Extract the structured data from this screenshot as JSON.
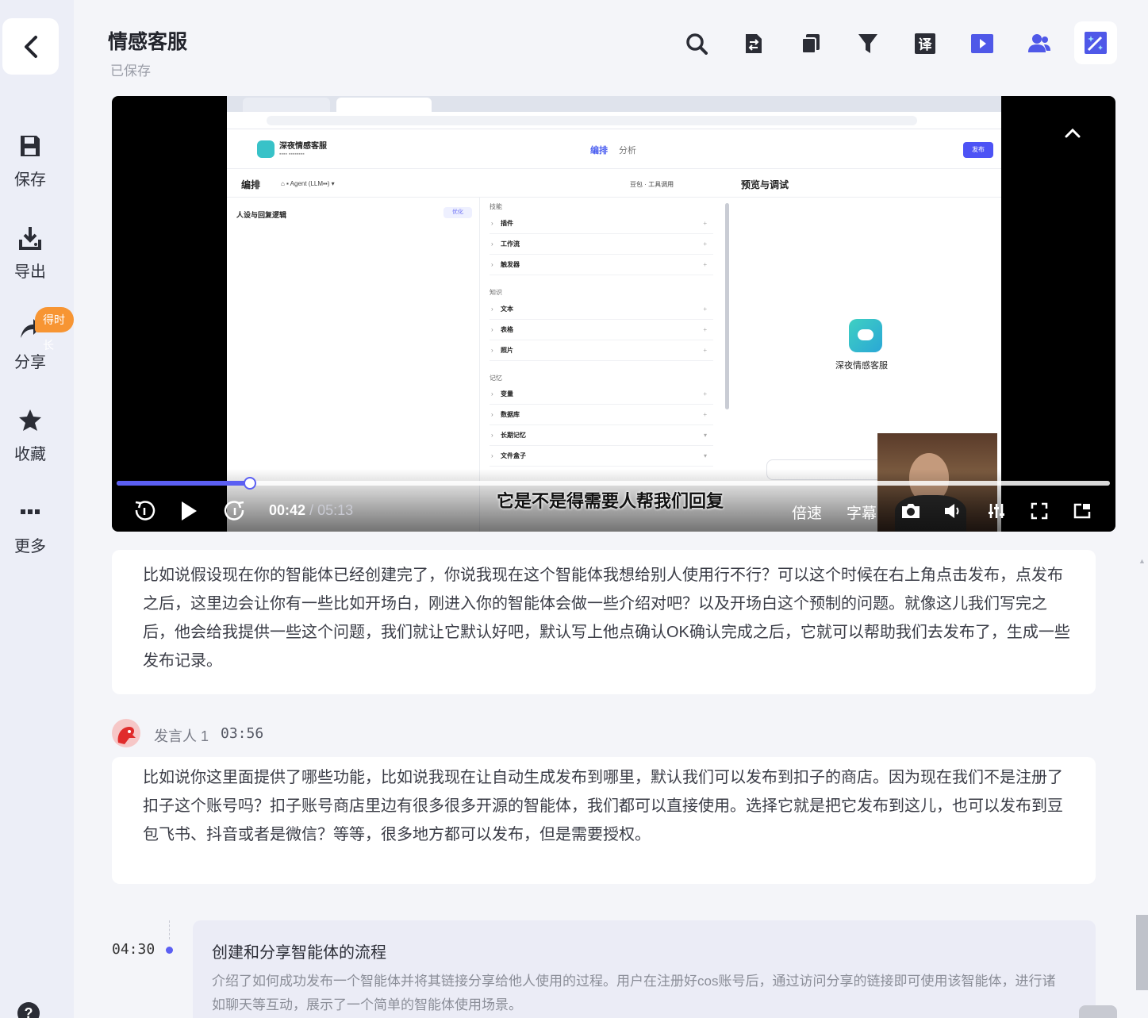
{
  "sidebar": {
    "items": [
      {
        "icon": "save-icon",
        "label": "保存"
      },
      {
        "icon": "export-icon",
        "label": "导出"
      },
      {
        "icon": "share-icon",
        "label": "分享"
      },
      {
        "icon": "star-icon",
        "label": "收藏"
      },
      {
        "icon": "more-icon",
        "label": "更多"
      }
    ],
    "share_badge": "得时长"
  },
  "header": {
    "title": "情感客服",
    "status": "已保存"
  },
  "toolbar": {
    "icons": [
      "search-icon",
      "summary-icon",
      "copy-icon",
      "filter-icon",
      "translate-icon",
      "video-icon",
      "speakers-icon",
      "magic-edit-icon"
    ],
    "translate_glyph": "译"
  },
  "video": {
    "current_time": "00:42",
    "duration": "05:13",
    "progress_fraction": 0.134,
    "subtitle": "它是不是得需要人帮我们回复",
    "speed_label": "倍速",
    "captions_label": "字幕",
    "screen": {
      "app_name": "深夜情感客服",
      "tab_edit": "编排",
      "tab_analyze": "分析",
      "publish": "发布",
      "section_edit": "编排",
      "model": "豆包 · 工具调用",
      "section_preview": "预览与调试",
      "persona_title": "人设与回复逻辑",
      "optimize": "优化",
      "skills_label": "技能",
      "skills": [
        "插件",
        "工作流",
        "触发器"
      ],
      "knowledge_label": "知识",
      "knowledge": [
        "文本",
        "表格",
        "照片"
      ],
      "memory_label": "记忆",
      "memory": [
        "变量",
        "数据库",
        "长期记忆",
        "文件盒子"
      ],
      "bot_name": "深夜情感客服"
    }
  },
  "transcript": [
    {
      "text": "比如说假设现在你的智能体已经创建完了，你说我现在这个智能体我想给别人使用行不行？可以这个时候在右上角点击发布，点发布之后，这里边会让你有一些比如开场白，刚进入你的智能体会做一些介绍对吧？以及开场白这个预制的问题。就像这儿我们写完之后，他会给我提供一些这个问题，我们就让它默认好吧，默认写上他点确认OK确认完成之后，它就可以帮助我们去发布了，生成一些发布记录。"
    },
    {
      "speaker": "发言人 1",
      "time": "03:56",
      "text": "比如说你这里面提供了哪些功能，比如说我现在让自动生成发布到哪里，默认我们可以发布到扣子的商店。因为现在我们不是注册了扣子这个账号吗？扣子账号商店里边有很多很多开源的智能体，我们都可以直接使用。选择它就是把它发布到这儿，也可以发布到豆包飞书、抖音或者是微信？等等，很多地方都可以发布，但是需要授权。"
    }
  ],
  "chapter": {
    "time": "04:30",
    "title": "创建和分享智能体的流程",
    "description": "介绍了如何成功发布一个智能体并将其链接分享给他人使用的过程。用户在注册好cos账号后，通过访问分享的链接即可使用该智能体，进行诸如聊天等互动，展示了一个简单的智能体使用场景。"
  },
  "colors": {
    "accent": "#5b5ff3",
    "badge": "#f79533",
    "sidebar_bg": "#eceef7"
  }
}
